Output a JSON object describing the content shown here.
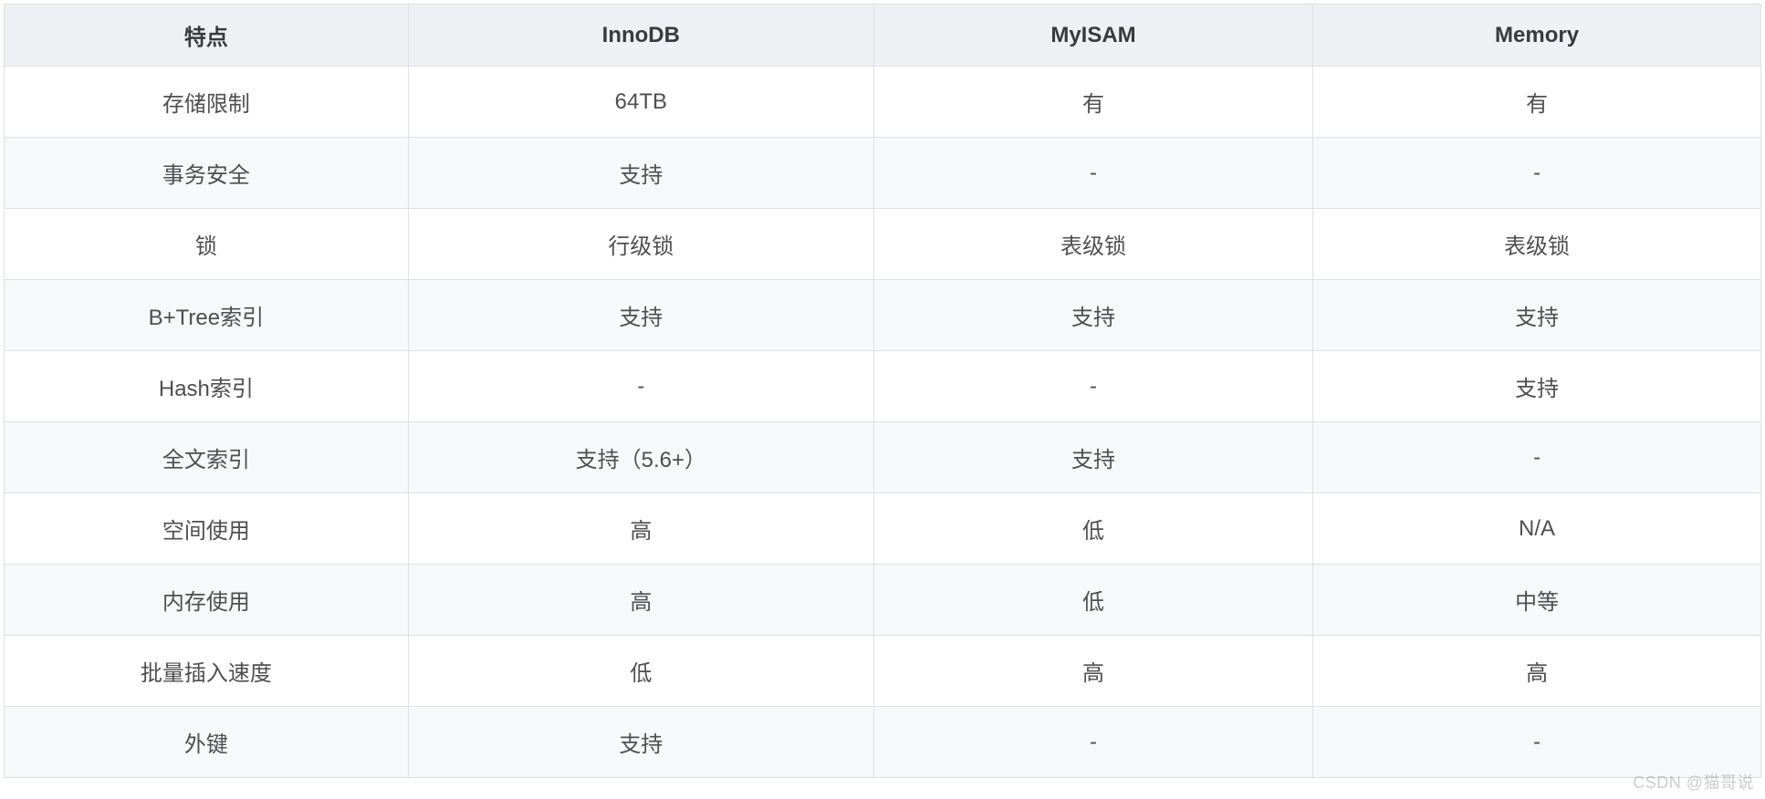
{
  "table": {
    "headers": [
      "特点",
      "InnoDB",
      "MyISAM",
      "Memory"
    ],
    "rows": [
      {
        "feature": "存储限制",
        "innodb": "64TB",
        "myisam": "有",
        "memory": "有"
      },
      {
        "feature": "事务安全",
        "innodb": "支持",
        "myisam": "-",
        "memory": "-"
      },
      {
        "feature": "锁",
        "innodb": "行级锁",
        "myisam": "表级锁",
        "memory": "表级锁"
      },
      {
        "feature": "B+Tree索引",
        "innodb": "支持",
        "myisam": "支持",
        "memory": "支持"
      },
      {
        "feature": "Hash索引",
        "innodb": "-",
        "myisam": "-",
        "memory": "支持"
      },
      {
        "feature": "全文索引",
        "innodb": "支持（5.6+）",
        "myisam": "支持",
        "memory": "-"
      },
      {
        "feature": "空间使用",
        "innodb": "高",
        "myisam": "低",
        "memory": "N/A"
      },
      {
        "feature": "内存使用",
        "innodb": "高",
        "myisam": "低",
        "memory": "中等"
      },
      {
        "feature": "批量插入速度",
        "innodb": "低",
        "myisam": "高",
        "memory": "高"
      },
      {
        "feature": "外键",
        "innodb": "支持",
        "myisam": "-",
        "memory": "-"
      }
    ]
  },
  "watermark": "CSDN @猫哥说"
}
